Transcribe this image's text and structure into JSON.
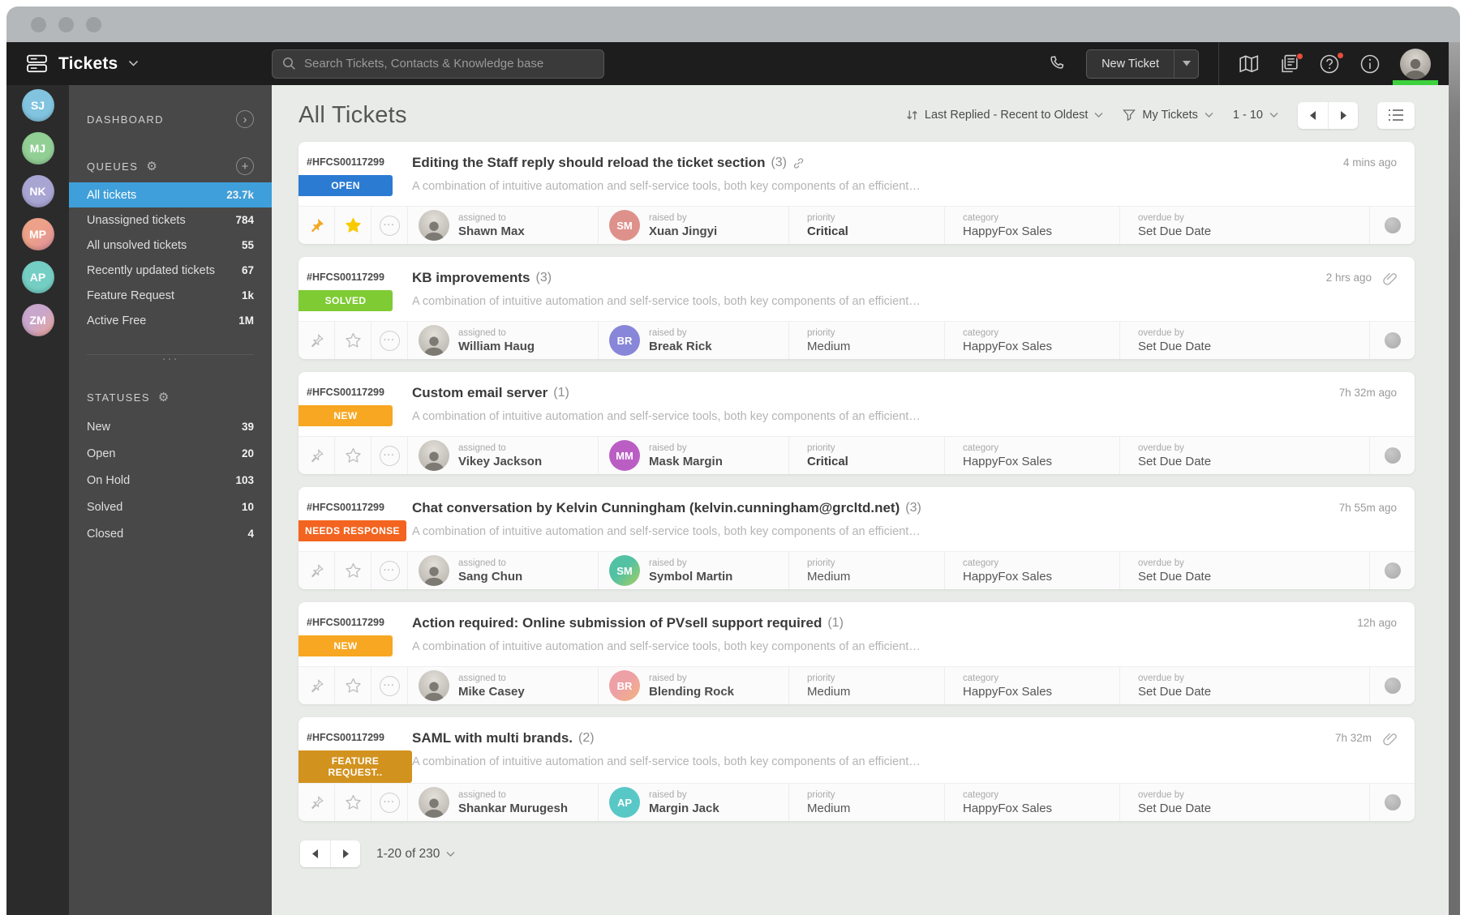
{
  "header": {
    "app_title": "Tickets",
    "search_placeholder": "Search Tickets, Contacts & Knowledge base",
    "new_ticket_label": "New Ticket"
  },
  "rail": {
    "users": [
      {
        "initials": "SJ",
        "color": "#82c4e0"
      },
      {
        "initials": "MJ",
        "color": "#92cf95"
      },
      {
        "initials": "NK",
        "color": "#a8a5d3"
      },
      {
        "initials": "MP",
        "color": "#eda188",
        "color2": "#dd8f9e"
      },
      {
        "initials": "AP",
        "color": "#74cec3"
      },
      {
        "initials": "ZM",
        "color": "#c9a6cb",
        "color2": "#eba597"
      }
    ]
  },
  "sidebar": {
    "dashboard_label": "DASHBOARD",
    "queues_label": "QUEUES",
    "statuses_label": "STATUSES",
    "queues": [
      {
        "label": "All tickets",
        "count": "23.7k",
        "selected": true
      },
      {
        "label": "Unassigned tickets",
        "count": "784"
      },
      {
        "label": "All unsolved tickets",
        "count": "55"
      },
      {
        "label": "Recently updated tickets",
        "count": "67"
      },
      {
        "label": "Feature Request",
        "count": "1k"
      },
      {
        "label": "Active Free",
        "count": "1M"
      }
    ],
    "statuses": [
      {
        "label": "New",
        "count": "39"
      },
      {
        "label": "Open",
        "count": "20"
      },
      {
        "label": "On Hold",
        "count": "103"
      },
      {
        "label": "Solved",
        "count": "10"
      },
      {
        "label": "Closed",
        "count": "4"
      }
    ]
  },
  "toolbar": {
    "title": "All Tickets",
    "sort_label": "Last Replied - Recent to Oldest",
    "filter_label": "My Tickets",
    "page_range": "1 - 10"
  },
  "labels": {
    "assigned_to": "assigned to",
    "raised_by": "raised by",
    "priority": "priority",
    "category": "category",
    "overdue_by": "overdue by"
  },
  "tickets": [
    {
      "id": "#HFCS00117299",
      "status": "OPEN",
      "status_color": "#2b7bd3",
      "title": "Editing the Staff reply should reload the ticket section",
      "reply_count": "(3)",
      "description": "A combination of intuitive automation and self-service tools, both key components of an efficient…",
      "time": "4 mins ago",
      "has_link": true,
      "has_attachment": false,
      "pinned": true,
      "starred": true,
      "assignee": "Shawn Max",
      "raiser": {
        "name": "Xuan Jingyi",
        "initials": "SM",
        "color": "#de918b"
      },
      "priority": "Critical",
      "category": "HappyFox Sales",
      "overdue": "Set Due Date"
    },
    {
      "id": "#HFCS00117299",
      "status": "SOLVED",
      "status_color": "#7ecb33",
      "title": "KB improvements",
      "reply_count": "(3)",
      "description": "A combination of intuitive automation and self-service tools, both key components of an efficient…",
      "time": "2 hrs ago",
      "has_link": false,
      "has_attachment": true,
      "pinned": false,
      "starred": false,
      "assignee": "William Haug",
      "raiser": {
        "name": "Break Rick",
        "initials": "BR",
        "color": "#8886d8"
      },
      "priority": "Medium",
      "category": "HappyFox Sales",
      "overdue": "Set Due Date"
    },
    {
      "id": "#HFCS00117299",
      "status": "NEW",
      "status_color": "#f7a722",
      "title": "Custom email server",
      "reply_count": "(1)",
      "description": "A combination of intuitive automation and self-service tools, both key components of an efficient…",
      "time": "7h 32m ago",
      "has_link": false,
      "has_attachment": false,
      "pinned": false,
      "starred": false,
      "assignee": "Vikey Jackson",
      "raiser": {
        "name": "Mask Margin",
        "initials": "MM",
        "color": "#ba5ec4"
      },
      "priority": "Critical",
      "category": "HappyFox Sales",
      "overdue": "Set Due Date"
    },
    {
      "id": "#HFCS00117299",
      "status": "NEEDS RESPONSE",
      "status_color": "#f2641f",
      "title": "Chat conversation by Kelvin Cunningham (kelvin.cunningham@grcltd.net)",
      "reply_count": "(3)",
      "description": "A combination of intuitive automation and self-service tools, both key components of an efficient…",
      "time": "7h 55m ago",
      "has_link": false,
      "has_attachment": false,
      "pinned": false,
      "starred": false,
      "assignee": "Sang Chun",
      "raiser": {
        "name": "Symbol Martin",
        "initials": "SM",
        "color": "#52c1a4",
        "color2": "#a8cf5f"
      },
      "priority": "Medium",
      "category": "HappyFox Sales",
      "overdue": "Set Due Date"
    },
    {
      "id": "#HFCS00117299",
      "status": "NEW",
      "status_color": "#f7a722",
      "title": "Action required: Online submission of PVsell support required",
      "reply_count": "(1)",
      "description": "A combination of intuitive automation and self-service tools, both key components of an efficient…",
      "time": "12h ago",
      "has_link": false,
      "has_attachment": false,
      "pinned": false,
      "starred": false,
      "assignee": "Mike Casey",
      "raiser": {
        "name": "Blending Rock",
        "initials": "BR",
        "color": "#eda0a6",
        "color2": "#f2b37e"
      },
      "priority": "Medium",
      "category": "HappyFox Sales",
      "overdue": "Set Due Date"
    },
    {
      "id": "#HFCS00117299",
      "status": "FEATURE REQUEST..",
      "status_color": "#d2921e",
      "title": "SAML with multi brands.",
      "reply_count": "(2)",
      "description": "A combination of intuitive automation and self-service tools, both key components of an efficient…",
      "time": "7h 32m",
      "has_link": false,
      "has_attachment": true,
      "pinned": false,
      "starred": false,
      "assignee": "Shankar Murugesh",
      "raiser": {
        "name": "Margin Jack",
        "initials": "AP",
        "color": "#58c8c6"
      },
      "priority": "Medium",
      "category": "HappyFox Sales",
      "overdue": "Set Due Date"
    }
  ],
  "pagination": {
    "range_label": "1-20 of 230"
  },
  "icons": {
    "gear": "⚙",
    "plus": "+",
    "chevron_right": "›",
    "more": "···",
    "divider_dots": "···"
  },
  "colors": {
    "selected_queue": "#3f9fda",
    "online_green": "#3ed13e",
    "notification_red": "#e84c3d",
    "header_bg": "#1d1d1d",
    "sidebar_bg": "#484848",
    "main_bg": "#e9ebe9"
  }
}
